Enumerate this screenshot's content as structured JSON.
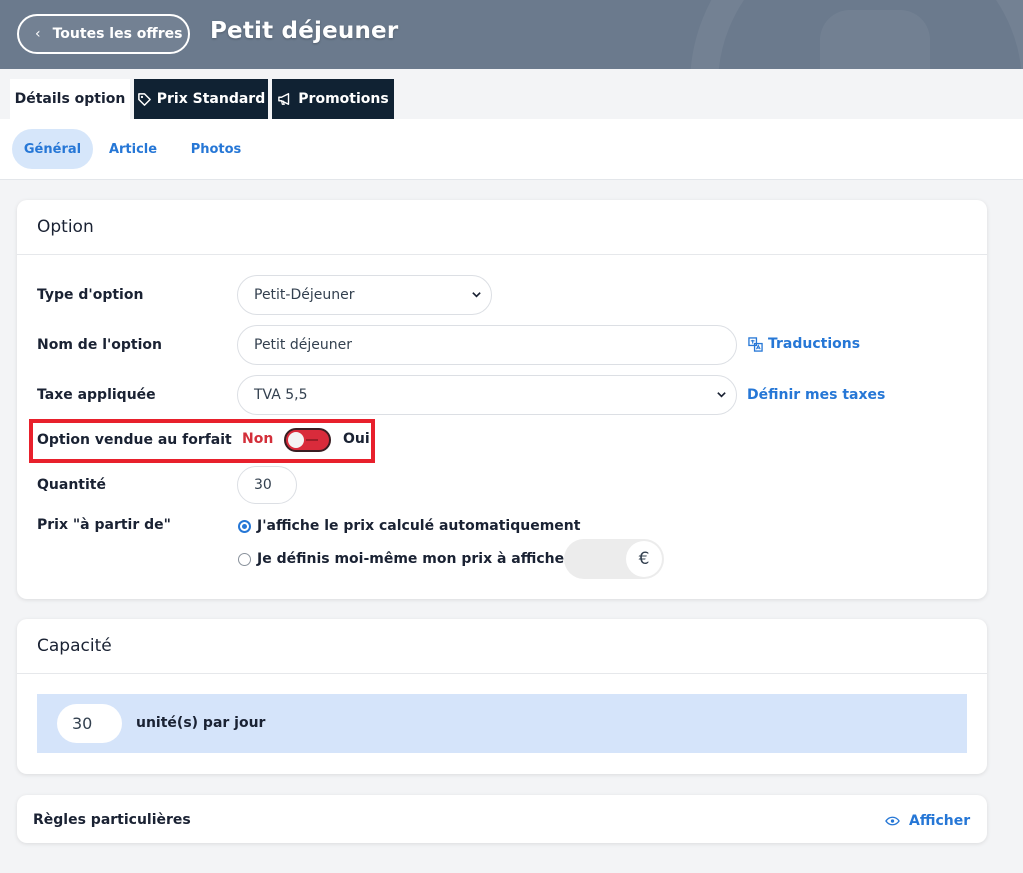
{
  "header": {
    "back_label": "Toutes les offres",
    "title": "Petit déjeuner"
  },
  "tabs": [
    {
      "label": "Détails option",
      "icon": null,
      "active": true
    },
    {
      "label": "Prix Standard",
      "icon": "tag-icon",
      "active": false
    },
    {
      "label": "Promotions",
      "icon": "megaphone-icon",
      "active": false
    }
  ],
  "subtabs": [
    {
      "label": "Général",
      "active": true
    },
    {
      "label": "Article",
      "active": false
    },
    {
      "label": "Photos",
      "active": false
    }
  ],
  "option": {
    "title": "Option",
    "type_label": "Type d'option",
    "type_value": "Petit-Déjeuner",
    "nom_label": "Nom de l'option",
    "nom_value": "Petit déjeuner",
    "traductions_link": "Traductions",
    "taxe_label": "Taxe appliquée",
    "taxe_value": "TVA 5,5",
    "taxes_link": "Définir mes taxes",
    "forfait_label": "Option vendue au forfait",
    "forfait_off": "Non",
    "forfait_on": "Oui",
    "forfait_enabled": false,
    "quantite_label": "Quantité",
    "quantite_value": "30",
    "prix_label": "Prix \"à partir de\"",
    "prix_options": [
      {
        "label": "J'affiche le prix calculé automatiquement",
        "checked": true
      },
      {
        "label": "Je définis moi-même mon prix à afficher",
        "checked": false
      }
    ],
    "currency": "€"
  },
  "capacite": {
    "title": "Capacité",
    "value": "30",
    "unit_label": "unité(s) par jour"
  },
  "regles": {
    "title": "Règles particulières",
    "afficher_label": "Afficher"
  },
  "colors": {
    "accent": "#2677d6",
    "dark_tab": "#102233",
    "toggle_off_red": "#d92b3b",
    "highlight": "#e8202c"
  }
}
